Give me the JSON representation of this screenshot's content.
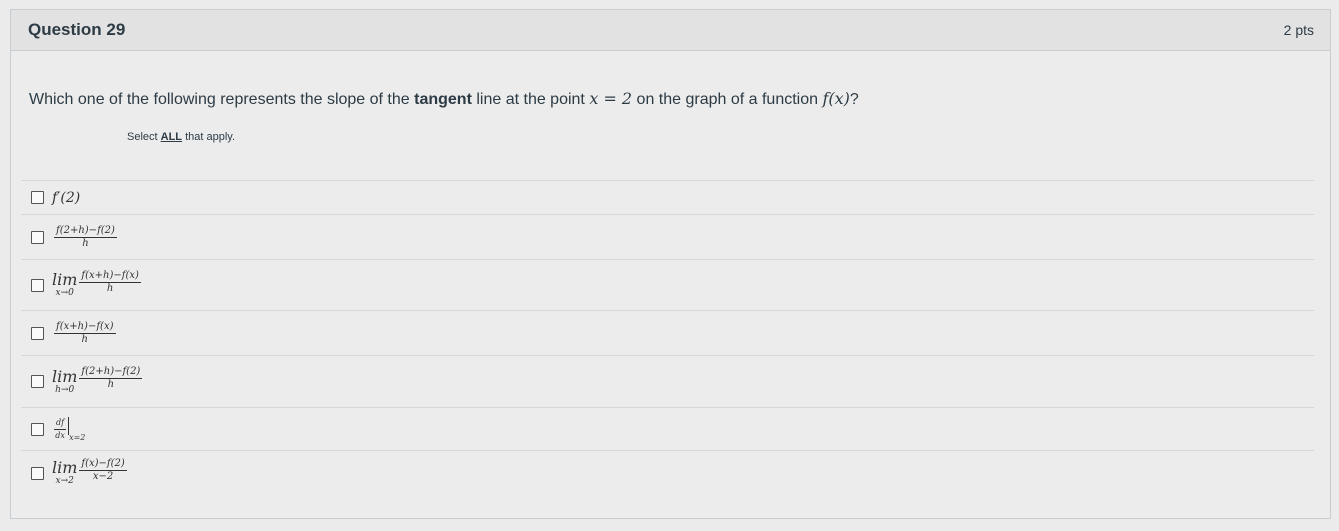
{
  "question": {
    "title": "Question 29",
    "points": "2 pts",
    "text_before": "Which one of the following represents the slope of the ",
    "text_bold": "tangent",
    "text_middle": " line at the point ",
    "point_expr": "x = 2",
    "text_after": " on the graph of a function ",
    "function_expr": "f(x)",
    "text_end": "?",
    "instruction_prefix": "Select ",
    "instruction_all": "ALL",
    "instruction_suffix": " that apply."
  },
  "answers": [
    {
      "type": "plain",
      "expr": "f′(2)"
    },
    {
      "type": "frac",
      "num": "f(2+h)−f(2)",
      "den": "h"
    },
    {
      "type": "limfrac",
      "lim": "lim",
      "sub": "x→0",
      "num": "f(x+h)−f(x)",
      "den": "h"
    },
    {
      "type": "frac",
      "num": "f(x+h)−f(x)",
      "den": "h"
    },
    {
      "type": "limfrac",
      "lim": "lim",
      "sub": "h→0",
      "num": "f(2+h)−f(2)",
      "den": "h"
    },
    {
      "type": "deriv",
      "num": "df",
      "den": "dx",
      "eval": "x=2"
    },
    {
      "type": "limfrac",
      "lim": "lim",
      "sub": "x→2",
      "num": "f(x)−f(2)",
      "den": "x−2"
    }
  ]
}
